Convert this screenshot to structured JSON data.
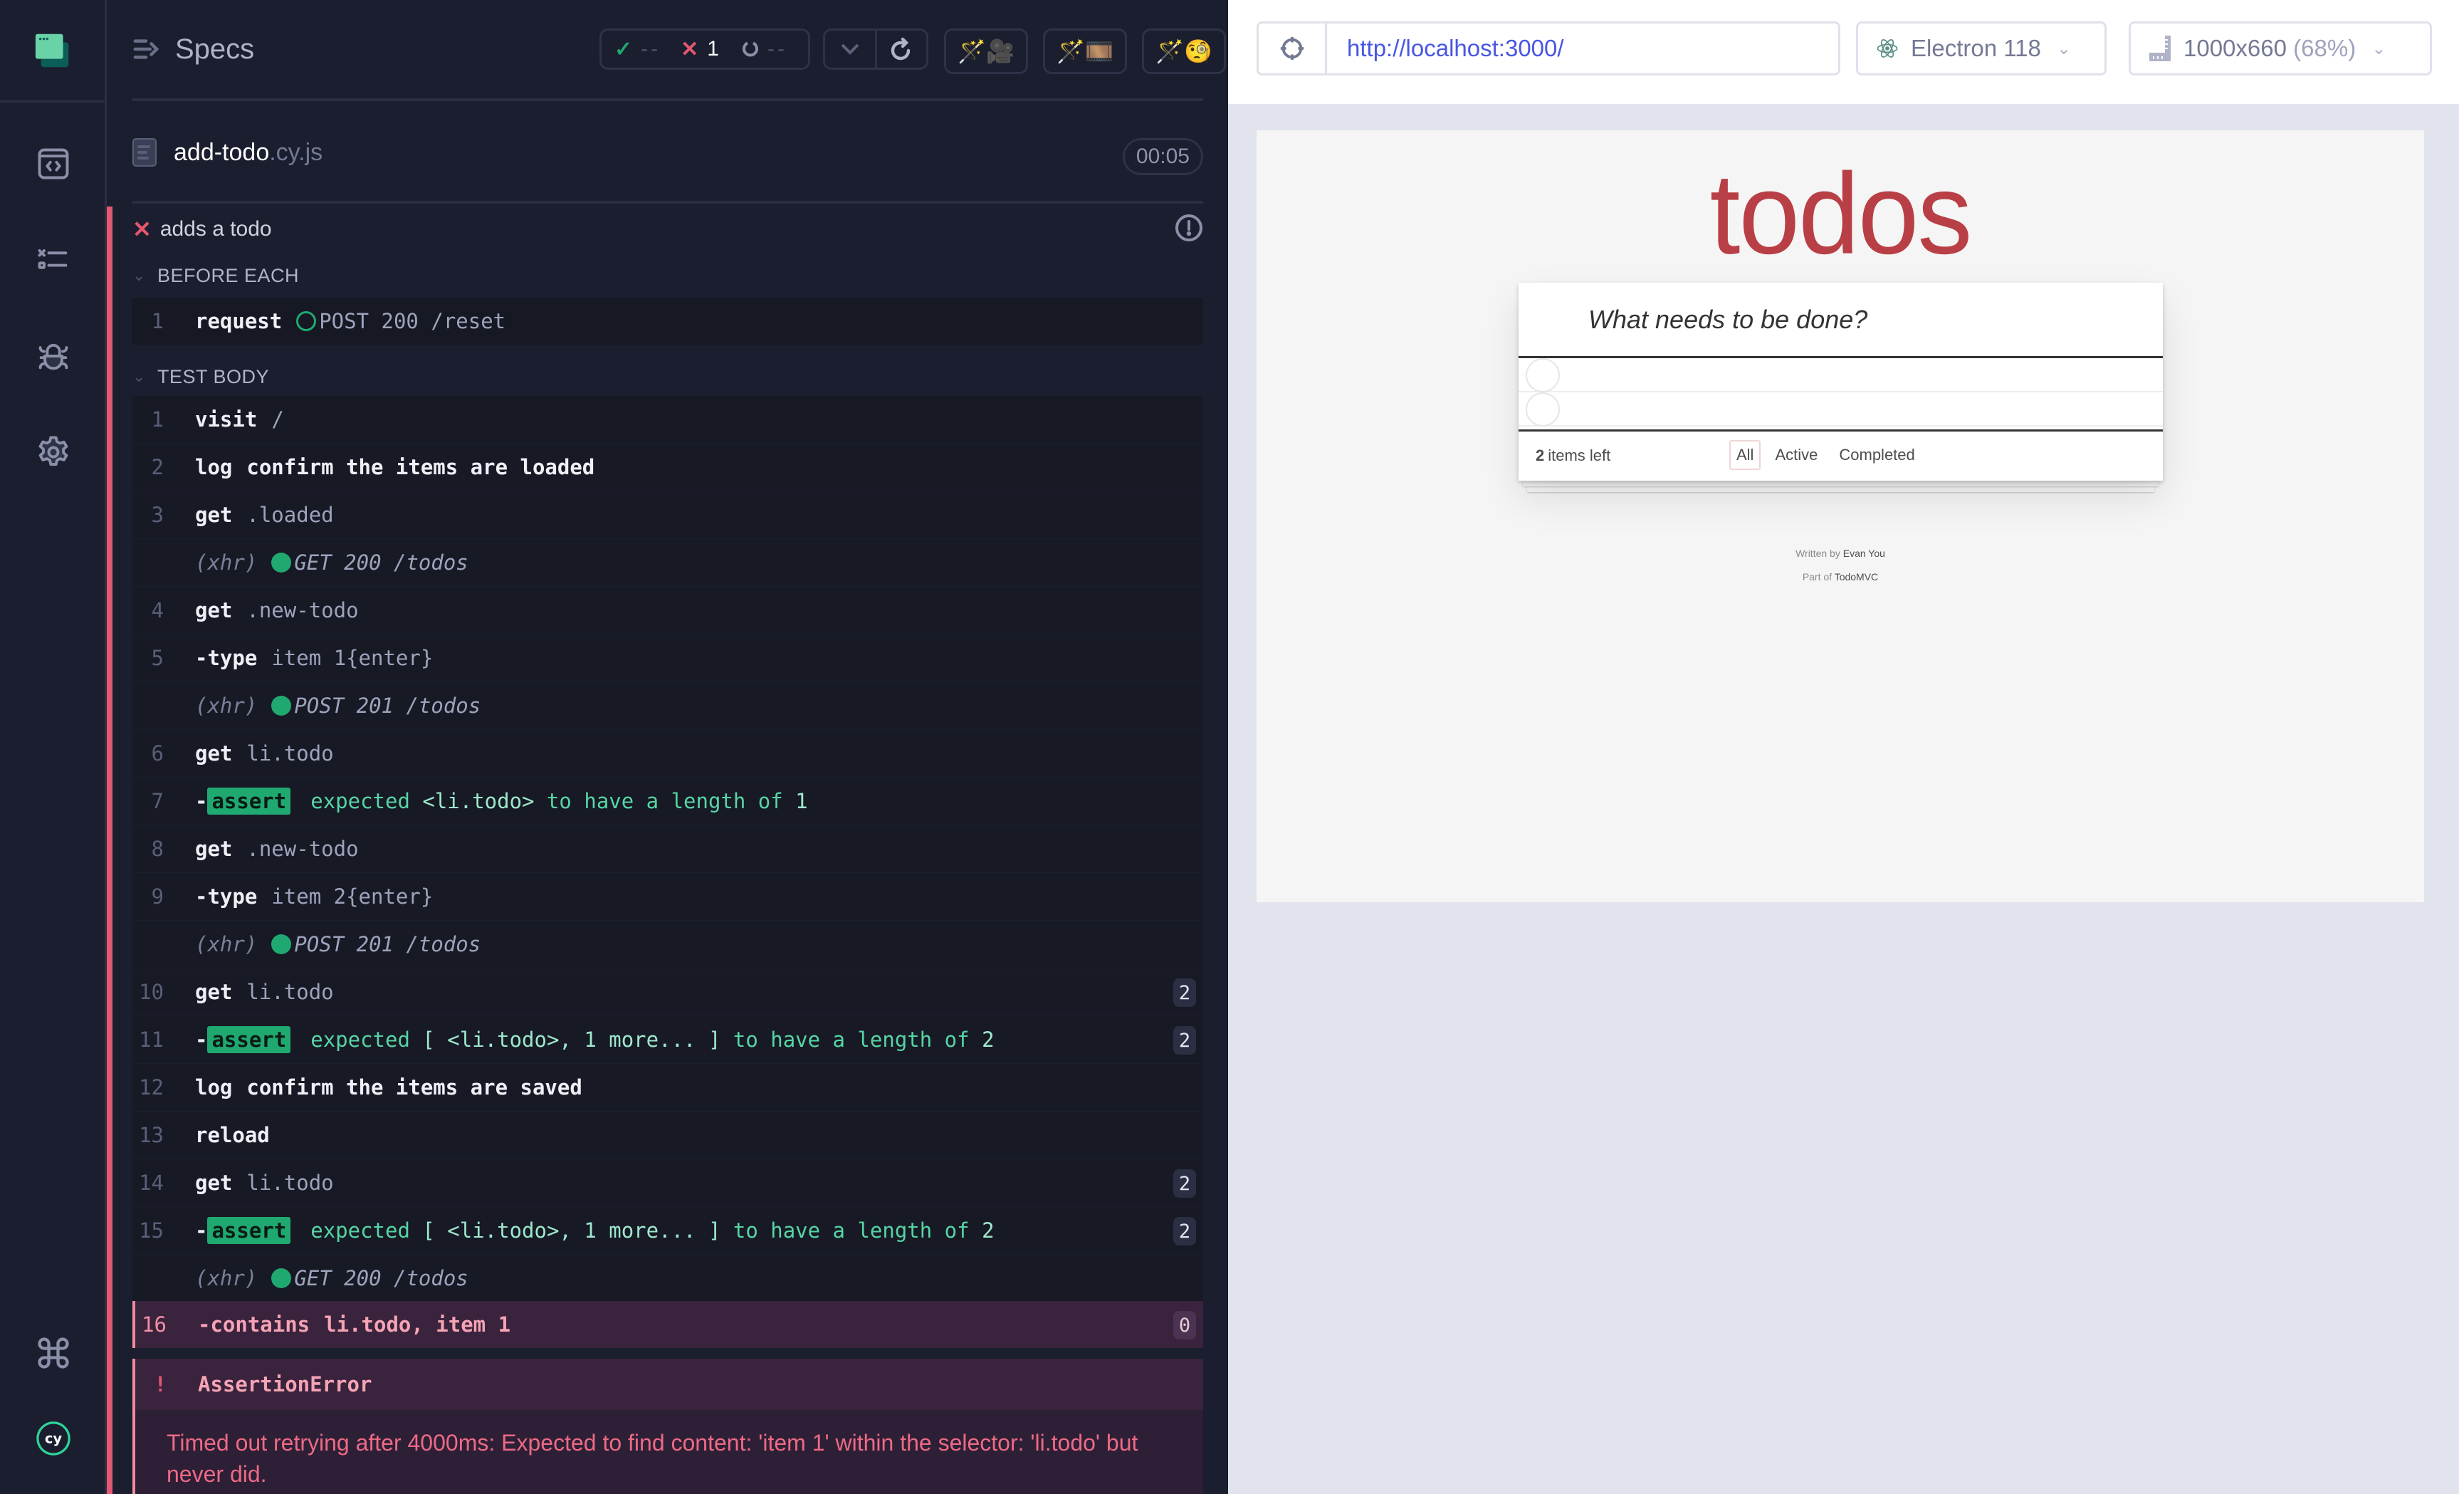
{
  "nav": {
    "items": [
      {
        "name": "specs",
        "icon": "code-window-icon"
      },
      {
        "name": "runs",
        "icon": "test-list-icon"
      },
      {
        "name": "debug",
        "icon": "bug-icon"
      },
      {
        "name": "settings",
        "icon": "gear-icon"
      }
    ],
    "bottom": [
      {
        "name": "keyboard-shortcuts",
        "icon": "command-icon"
      },
      {
        "name": "cypress-logo",
        "icon": "cy-logo-icon",
        "label": "cy"
      }
    ]
  },
  "reporter": {
    "header": {
      "specs_label": "Specs",
      "stats": {
        "passed": "--",
        "failed": "1",
        "pending": "--"
      },
      "studio_buttons": [
        {
          "name": "studio-record",
          "emoji": "🪄🎥"
        },
        {
          "name": "studio-film",
          "emoji": "🪄🎞️"
        },
        {
          "name": "studio-inspect",
          "emoji": "🪄🧐"
        }
      ]
    },
    "spec": {
      "name": "add-todo",
      "ext": ".cy.js",
      "duration": "00:05"
    },
    "test": {
      "status": "failed",
      "title": "adds a todo"
    },
    "hooks": {
      "before_each": "BEFORE EACH",
      "test_body": "TEST BODY"
    },
    "before_each_commands": [
      {
        "num": "1",
        "name": "request",
        "type": "request",
        "status_dot": "hollow",
        "msg": "POST 200 /reset"
      }
    ],
    "commands": [
      {
        "num": "1",
        "name": "visit",
        "msg": "/"
      },
      {
        "num": "2",
        "name": "log",
        "msg": "confirm the items are loaded",
        "msg_style": "white"
      },
      {
        "num": "3",
        "name": "get",
        "msg": ".loaded"
      },
      {
        "num": "",
        "type": "xhr",
        "name": "(xhr)",
        "msg": "GET 200 /todos"
      },
      {
        "num": "4",
        "name": "get",
        "msg": ".new-todo"
      },
      {
        "num": "5",
        "name": "-type",
        "msg": "item 1{enter}"
      },
      {
        "num": "",
        "type": "xhr",
        "name": "(xhr)",
        "msg": "POST 201 /todos"
      },
      {
        "num": "6",
        "name": "get",
        "msg": "li.todo"
      },
      {
        "num": "7",
        "type": "assert",
        "name": "assert",
        "pre": "expected ",
        "hl": "<li.todo>",
        "post": " to have a length of ",
        "val": "1"
      },
      {
        "num": "8",
        "name": "get",
        "msg": ".new-todo"
      },
      {
        "num": "9",
        "name": "-type",
        "msg": "item 2{enter}"
      },
      {
        "num": "",
        "type": "xhr",
        "name": "(xhr)",
        "msg": "POST 201 /todos"
      },
      {
        "num": "10",
        "name": "get",
        "msg": "li.todo",
        "count": "2"
      },
      {
        "num": "11",
        "type": "assert",
        "name": "assert",
        "pre": "expected ",
        "hl": "[ <li.todo>, 1 more... ]",
        "post": " to have a length of ",
        "val": "2",
        "count": "2"
      },
      {
        "num": "12",
        "name": "log",
        "msg": "confirm the items are saved",
        "msg_style": "white"
      },
      {
        "num": "13",
        "name": "reload",
        "msg": ""
      },
      {
        "num": "14",
        "name": "get",
        "msg": "li.todo",
        "count": "2"
      },
      {
        "num": "15",
        "type": "assert",
        "name": "assert",
        "pre": "expected ",
        "hl": "[ <li.todo>, 1 more... ]",
        "post": " to have a length of ",
        "val": "2",
        "count": "2"
      },
      {
        "num": "",
        "type": "xhr",
        "name": "(xhr)",
        "msg": "GET 200 /todos"
      },
      {
        "num": "16",
        "type": "failed",
        "name": "-contains",
        "msg": "li.todo, item 1",
        "count": "0"
      }
    ],
    "error": {
      "icon": "!",
      "name": "AssertionError",
      "message": "Timed out retrying after 4000ms: Expected to find content: 'item 1' within the selector: 'li.todo' but never did."
    }
  },
  "browser": {
    "url": "http://localhost:3000/",
    "browser_name": "Electron 118",
    "viewport_size": "1000x660",
    "viewport_scale": "(68%)"
  },
  "app": {
    "title": "todos",
    "input_placeholder": "What needs to be done?",
    "items_count": "2",
    "items_left_label": "items left",
    "filters": [
      "All",
      "Active",
      "Completed"
    ],
    "selected_filter": "All",
    "todo_rows": 2,
    "written_by_label": "Written by",
    "author": "Evan You",
    "part_of_label": "Part of",
    "project": "TodoMVC"
  },
  "colors": {
    "fail": "#e45770",
    "pass": "#1fa971",
    "accent_link": "#4956e3",
    "todo_title": "#b83f45"
  }
}
